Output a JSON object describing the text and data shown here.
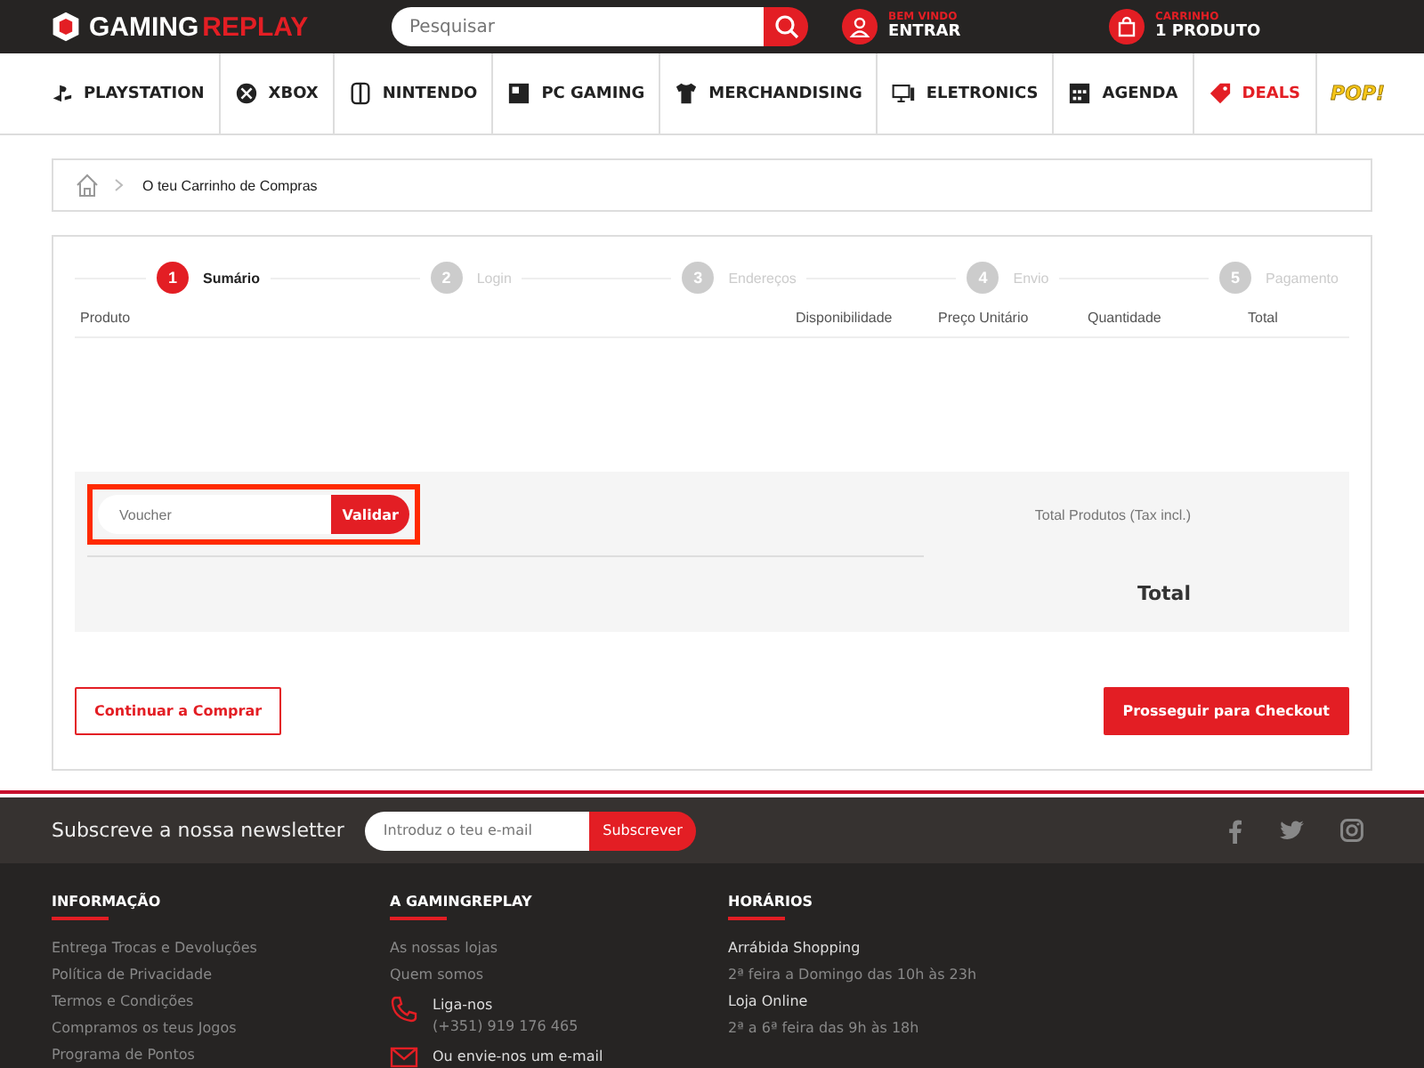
{
  "header": {
    "logo": {
      "first": "GAMING",
      "second": "REPLAY"
    },
    "search": {
      "placeholder": "Pesquisar"
    },
    "account": {
      "caption": "BEM VINDO",
      "label": "ENTRAR"
    },
    "cart": {
      "caption": "CARRINHO",
      "label": "1 PRODUTO"
    }
  },
  "nav": [
    {
      "label": "PLAYSTATION",
      "kind": "playstation",
      "highlighted": false
    },
    {
      "label": "XBOX",
      "kind": "xbox",
      "highlighted": false
    },
    {
      "label": "NINTENDO",
      "kind": "switch",
      "highlighted": false
    },
    {
      "label": "PC GAMING",
      "kind": "pc",
      "highlighted": false
    },
    {
      "label": "MERCHANDISING",
      "kind": "shirt",
      "highlighted": false
    },
    {
      "label": "ELETRONICS",
      "kind": "monitor",
      "highlighted": false
    },
    {
      "label": "AGENDA",
      "kind": "calendar",
      "highlighted": false
    },
    {
      "label": "DEALS",
      "kind": "tag",
      "highlighted": true
    },
    {
      "label": "POP!",
      "kind": "logo",
      "highlighted": false
    }
  ],
  "breadcrumb": {
    "current": "O teu Carrinho de Compras"
  },
  "steps": [
    {
      "number": "1",
      "label": "Sumário",
      "selected": true
    },
    {
      "number": "2",
      "label": "Login",
      "selected": false
    },
    {
      "number": "3",
      "label": "Endereços",
      "selected": false
    },
    {
      "number": "4",
      "label": "Envio",
      "selected": false
    },
    {
      "number": "5",
      "label": "Pagamento",
      "selected": false
    }
  ],
  "table": {
    "columns": [
      "Produto",
      "Disponibilidade",
      "Preço Unitário",
      "Quantidade",
      "Total"
    ]
  },
  "voucher": {
    "placeholder": "Voucher",
    "button": "Validar",
    "highlighted": true
  },
  "summary": {
    "subtotal_label": "Total Produtos (Tax incl.)",
    "total_label": "Total"
  },
  "buttons": {
    "continue": "Continuar a Comprar",
    "checkout": "Prosseguir para Checkout"
  },
  "newsletter": {
    "title": "Subscreve a nossa newsletter",
    "placeholder": "Introduz o teu e-mail",
    "button": "Subscrever"
  },
  "footer": {
    "columns": [
      {
        "title": "INFORMAÇÃO",
        "items": [
          {
            "kind": "link",
            "text": "Entrega Trocas e Devoluções"
          },
          {
            "kind": "link",
            "text": "Política de Privacidade"
          },
          {
            "kind": "link",
            "text": "Termos e Condições"
          },
          {
            "kind": "link",
            "text": "Compramos os teus Jogos"
          },
          {
            "kind": "link",
            "text": "Programa de Pontos"
          }
        ]
      },
      {
        "title": "A GAMINGREPLAY",
        "items": [
          {
            "kind": "link",
            "text": "As nossas lojas"
          },
          {
            "kind": "link",
            "text": "Quem somos"
          },
          {
            "kind": "phone",
            "text": "Liga-nos",
            "sub": "(+351) 919 176 465"
          },
          {
            "kind": "mail",
            "text": "Ou envie-nos um e-mail"
          }
        ]
      },
      {
        "title": "HORÁRIOS",
        "items": [
          {
            "kind": "heading",
            "text": "Arrábida Shopping"
          },
          {
            "kind": "note",
            "text": "2ª feira a Domingo das 10h às 23h"
          },
          {
            "kind": "heading",
            "text": "Loja Online"
          },
          {
            "kind": "note",
            "text": "2ª a 6ª feira das 9h às 18h"
          }
        ]
      }
    ]
  }
}
